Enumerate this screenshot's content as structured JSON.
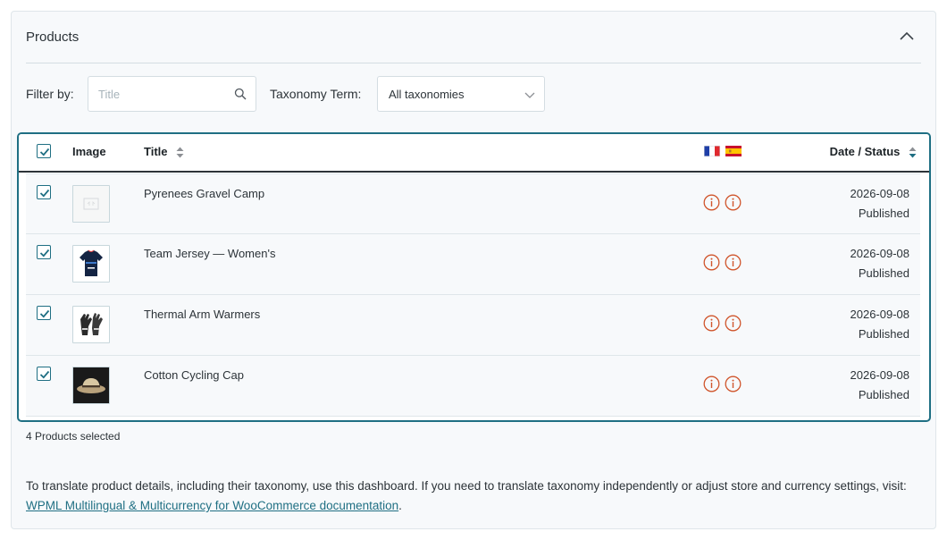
{
  "panel": {
    "title": "Products"
  },
  "filters": {
    "filter_label": "Filter by:",
    "search_placeholder": "Title",
    "search_value": "",
    "taxonomy_label": "Taxonomy Term:",
    "taxonomy_value": "All taxonomies"
  },
  "table": {
    "headers": {
      "image": "Image",
      "title": "Title",
      "date_status": "Date / Status"
    },
    "languages": [
      "fr-flag-icon",
      "es-flag-icon"
    ],
    "rows": [
      {
        "title": "Pyrenees Gravel Camp",
        "date": "2026-09-08",
        "status": "Published",
        "thumb": "placeholder-image-icon",
        "checked": true
      },
      {
        "title": "Team Jersey — Women's",
        "date": "2026-09-08",
        "status": "Published",
        "thumb": "jersey-image",
        "checked": true
      },
      {
        "title": "Thermal Arm Warmers",
        "date": "2026-09-08",
        "status": "Published",
        "thumb": "gloves-image",
        "checked": true
      },
      {
        "title": "Cotton Cycling Cap",
        "date": "2026-09-08",
        "status": "Published",
        "thumb": "cap-image",
        "checked": true
      }
    ]
  },
  "summary": {
    "selected_text": "4 Products selected"
  },
  "footer": {
    "text": "To translate product details, including their taxonomy, use this dashboard. If you need to translate taxonomy independently or adjust store and currency settings, visit: ",
    "link_text": "WPML Multilingual & Multicurrency for WooCommerce documentation",
    "after_link": "."
  },
  "colors": {
    "accent": "#1f6f83",
    "warning": "#d0552c",
    "panel_bg": "#f7f9fb"
  }
}
